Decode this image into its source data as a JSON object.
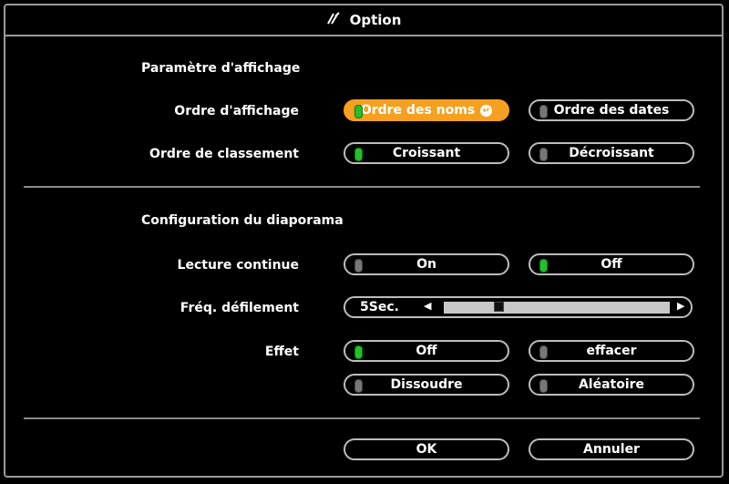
{
  "window": {
    "title": "Option",
    "title_icon": "tools-icon"
  },
  "display_section": {
    "title": "Paramètre d'affichage",
    "display_order": {
      "label": "Ordre d'affichage",
      "options": [
        "Ordre des noms",
        "Ordre des dates"
      ],
      "selected": "Ordre des noms"
    },
    "sort_order": {
      "label": "Ordre de classement",
      "options": [
        "Croissant",
        "Décroissant"
      ],
      "selected": "Croissant"
    }
  },
  "slideshow_section": {
    "title": "Configuration du diaporama",
    "continuous_play": {
      "label": "Lecture continue",
      "options": [
        "On",
        "Off"
      ],
      "selected": "Off"
    },
    "scroll_freq": {
      "label": "Fréq. défilement",
      "value_text": "5Sec.",
      "position_fraction": 0.23
    },
    "effect": {
      "label": "Effet",
      "options": [
        "Off",
        "effacer",
        "Dissoudre",
        "Aléatoire"
      ],
      "selected": "Off"
    }
  },
  "footer": {
    "ok_label": "OK",
    "cancel_label": "Annuler"
  },
  "colors": {
    "accent": "#f5a020",
    "led_on": "#22c02a",
    "led_off": "#777777"
  }
}
